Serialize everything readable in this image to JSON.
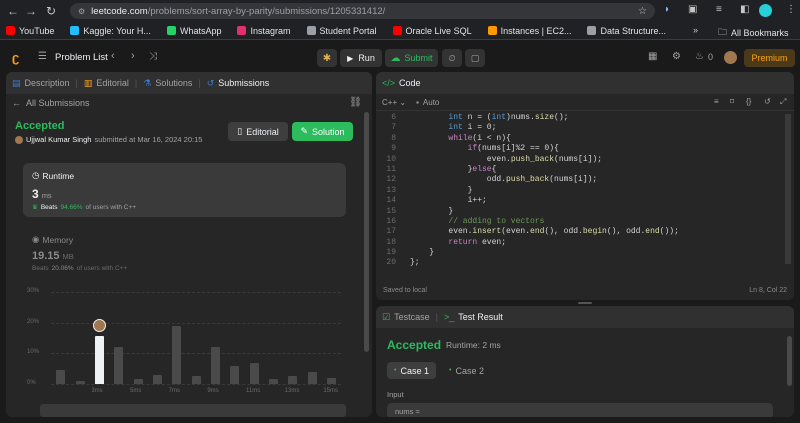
{
  "browser": {
    "url_domain": "leetcode.com",
    "url_path": "/problems/sort-array-by-parity/submissions/1205331412/",
    "bookmarks": [
      {
        "label": "YouTube",
        "color": "#ff0000"
      },
      {
        "label": "Kaggle: Your H...",
        "color": "#20beff"
      },
      {
        "label": "WhatsApp",
        "color": "#25d366"
      },
      {
        "label": "Instagram",
        "color": "#e1306c"
      },
      {
        "label": "Student Portal",
        "color": "#9aa0a6"
      },
      {
        "label": "Oracle Live SQL",
        "color": "#f80000"
      },
      {
        "label": "Instances | EC2...",
        "color": "#ff9900"
      },
      {
        "label": "Data Structure...",
        "color": "#9aa0a6"
      }
    ],
    "all_bookmarks": "All Bookmarks"
  },
  "topbar": {
    "problem_list": "Problem List",
    "run": "Run",
    "submit": "Submit",
    "points": "0",
    "premium": "Premium"
  },
  "left_tabs": {
    "description": "Description",
    "editorial": "Editorial",
    "solutions": "Solutions",
    "submissions": "Submissions"
  },
  "submission": {
    "all_submissions": "All Submissions",
    "status": "Accepted",
    "user": "Ujjwal Kumar Singh",
    "submitted_at": "submitted at Mar 16, 2024 20:15",
    "editorial_btn": "Editorial",
    "solution_btn": "Solution",
    "runtime_label": "Runtime",
    "runtime_value": "3",
    "runtime_unit": "ms",
    "runtime_beats_prefix": "Beats",
    "runtime_beats": "94.66%",
    "runtime_beats_suffix": "of users with C++",
    "memory_label": "Memory",
    "memory_value": "19.15",
    "memory_unit": "MB",
    "memory_beats_prefix": "Beats",
    "memory_beats": "20.06%",
    "memory_beats_suffix": "of users with C++"
  },
  "chart_data": {
    "type": "bar",
    "y_ticks": [
      "30%",
      "20%",
      "10%",
      "0%"
    ],
    "ylim": [
      0,
      30
    ],
    "x_ticks": [
      "3ms",
      "5ms",
      "7ms",
      "9ms",
      "11ms",
      "13ms",
      "15ms"
    ],
    "values": [
      4.5,
      1,
      15.5,
      12,
      1.5,
      3,
      19,
      2.5,
      12,
      6,
      7,
      1.5,
      2.5,
      4,
      2
    ],
    "highlight_index": 2
  },
  "code": {
    "title": "Code",
    "lang": "C++",
    "auto": "Auto",
    "saved": "Saved to local",
    "cursor": "Ln 8, Col 22",
    "lines": [
      {
        "n": "6",
        "indent": 8,
        "html": "<span class='ty'>int</span><span class='tx'> n = (</span><span class='ty'>int</span><span class='tx'>)nums.</span><span class='fn'>size</span><span class='tx'>();</span>"
      },
      {
        "n": "7",
        "indent": 8,
        "html": "<span class='ty'>int</span><span class='tx'> i = 0;</span>"
      },
      {
        "n": "8",
        "indent": 8,
        "html": "<span class='kw'>while</span><span class='tx'>(i &lt; n){</span>"
      },
      {
        "n": "9",
        "indent": 12,
        "html": "<span class='kw'>if</span><span class='tx'>(nums[i]%2 == 0){</span>"
      },
      {
        "n": "10",
        "indent": 16,
        "html": "<span class='tx'>even.</span><span class='fn'>push_back</span><span class='tx'>(nums[i]);</span>"
      },
      {
        "n": "11",
        "indent": 12,
        "html": "<span class='tx'>}</span><span class='kw'>else</span><span class='tx'>{</span>"
      },
      {
        "n": "12",
        "indent": 16,
        "html": "<span class='tx'>odd.</span><span class='fn'>push_back</span><span class='tx'>(nums[i]);</span>"
      },
      {
        "n": "13",
        "indent": 12,
        "html": "<span class='tx'>}</span>"
      },
      {
        "n": "14",
        "indent": 12,
        "html": "<span class='tx'>i++;</span>"
      },
      {
        "n": "15",
        "indent": 8,
        "html": "<span class='tx'>}</span>"
      },
      {
        "n": "16",
        "indent": 8,
        "html": "<span class='cm'>// adding to vectors</span>"
      },
      {
        "n": "17",
        "indent": 8,
        "html": "<span class='tx'>even.</span><span class='fn'>insert</span><span class='tx'>(even.</span><span class='fn'>end</span><span class='tx'>(), odd.</span><span class='fn'>begin</span><span class='tx'>(), odd.</span><span class='fn'>end</span><span class='tx'>());</span>"
      },
      {
        "n": "18",
        "indent": 8,
        "html": "<span class='kw'>return</span><span class='tx'> even;</span>"
      },
      {
        "n": "19",
        "indent": 4,
        "html": "<span class='tx'>}</span>"
      },
      {
        "n": "20",
        "indent": 0,
        "html": "<span class='tx'>};</span>"
      }
    ]
  },
  "result": {
    "testcase_tab": "Testcase",
    "result_tab": "Test Result",
    "status": "Accepted",
    "runtime": "Runtime: 2 ms",
    "case1": "Case 1",
    "case2": "Case 2",
    "input_label": "Input",
    "input_value": "nums ="
  }
}
